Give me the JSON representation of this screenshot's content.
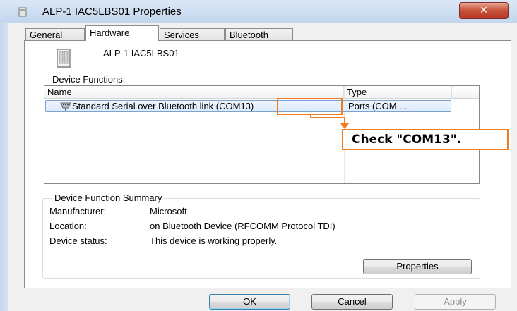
{
  "window": {
    "title": "ALP-1 IAC5LBS01 Properties",
    "close_glyph": "✕"
  },
  "tabs": [
    {
      "label": "General",
      "active": false
    },
    {
      "label": "Hardware",
      "active": true
    },
    {
      "label": "Services",
      "active": false
    },
    {
      "label": "Bluetooth",
      "active": false
    }
  ],
  "device": {
    "name": "ALP-1 IAC5LBS01",
    "icon": "device-icon"
  },
  "device_functions": {
    "label": "Device Functions:",
    "columns": {
      "name": "Name",
      "type": "Type"
    },
    "rows": [
      {
        "name": "Standard Serial over Bluetooth link (COM13)",
        "type": "Ports (COM ...",
        "icon": "serial-port-icon"
      }
    ]
  },
  "annotation": {
    "text": "Check \"COM13\".",
    "color": "#f07c20"
  },
  "summary": {
    "legend": "Device Function Summary",
    "fields": [
      {
        "label": "Manufacturer:",
        "value": "Microsoft"
      },
      {
        "label": "Location:",
        "value": "on Bluetooth Device (RFCOMM Protocol TDI)"
      },
      {
        "label": "Device status:",
        "value": "This device is working properly."
      }
    ],
    "properties_button": "Properties"
  },
  "footer": {
    "ok": "OK",
    "cancel": "Cancel",
    "apply": "Apply"
  }
}
